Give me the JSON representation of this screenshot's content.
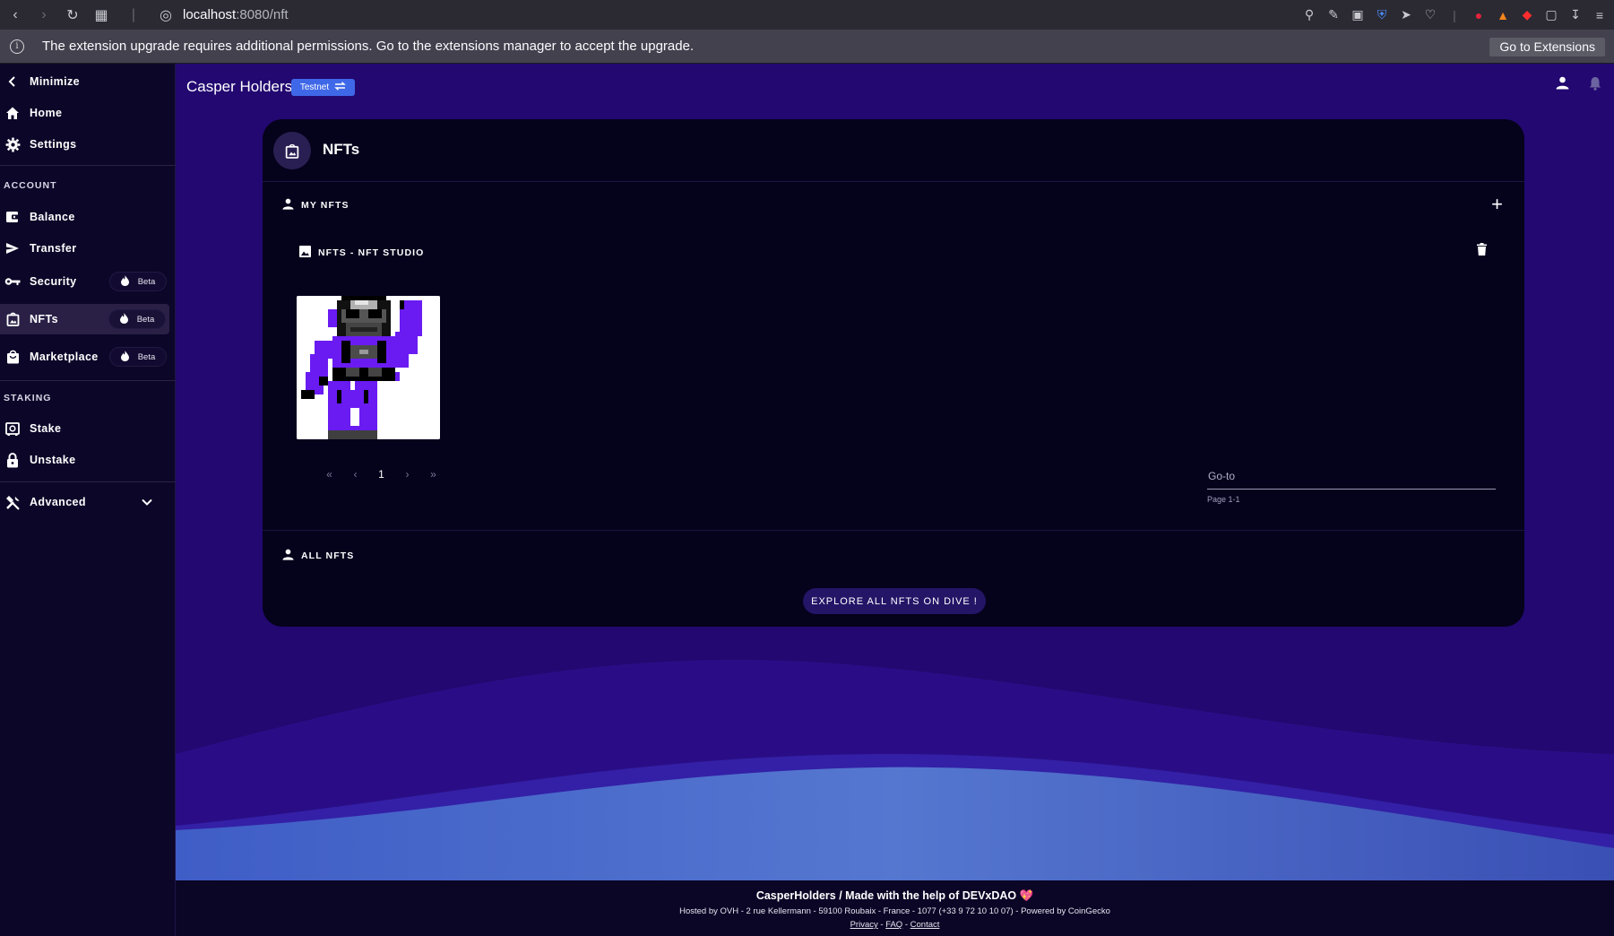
{
  "browser": {
    "url_host": "localhost",
    "url_path": ":8080/nft",
    "notification_text": "The extension upgrade requires additional permissions. Go to the extensions manager to accept the upgrade.",
    "notification_button": "Go to Extensions"
  },
  "sidebar": {
    "minimize": "Minimize",
    "home": "Home",
    "settings": "Settings",
    "account_section": "ACCOUNT",
    "balance": "Balance",
    "transfer": "Transfer",
    "security": "Security",
    "nfts": "NFTs",
    "marketplace": "Marketplace",
    "beta": "Beta",
    "staking_section": "STAKING",
    "stake": "Stake",
    "unstake": "Unstake",
    "advanced": "Advanced"
  },
  "header": {
    "title": "Casper Holders",
    "network_badge": "Testnet"
  },
  "card": {
    "title": "NFTs",
    "my_nfts_label": "MY NFTS",
    "collection_label": "NFTS - NFT STUDIO",
    "pager_current": "1",
    "goto_label": "Go-to",
    "goto_hint": "Page 1-1",
    "all_nfts_label": "ALL NFTS",
    "explore_button": "EXPLORE ALL NFTS ON DIVE !"
  },
  "footer": {
    "line1": "CasperHolders / Made with the help of DEVxDAO 💖",
    "line2": "Hosted by OVH - 2 rue Kellermann - 59100 Roubaix - France - 1077 (+33 9 72 10 10 07) - Powered by CoinGecko",
    "privacy": "Privacy",
    "faq": "FAQ",
    "contact": "Contact"
  },
  "colors": {
    "main_bg": "#220870",
    "card_bg": "#05021c",
    "sidebar_bg": "#0c0628",
    "testnet_badge": "#3f68e8",
    "explore_button": "#241567",
    "nft_purple": "#6a1bf2"
  }
}
